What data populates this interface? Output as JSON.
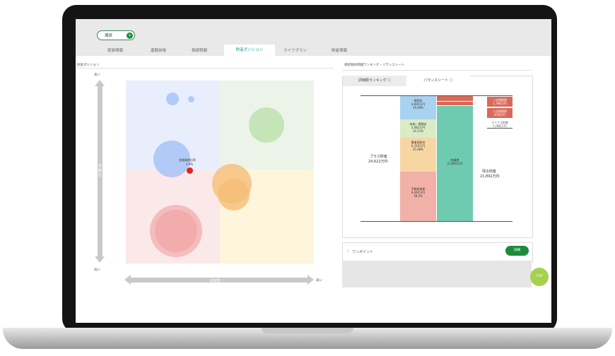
{
  "header": {
    "status_pill": "現状",
    "tabs": [
      "家族情報",
      "還暦前後",
      "相続税額",
      "財産ポジション",
      "ライフプラン",
      "財産情報"
    ],
    "active_tab": "財産ポジション"
  },
  "left_panel": {
    "title": "財産ポジション",
    "y_high": "高い",
    "y_low": "低い",
    "y_axis": "流動性",
    "x_axis": "収益性",
    "x_high": "高い",
    "marker_label": "金融資産比率",
    "marker_value": "1.8%"
  },
  "right_panel": {
    "title": "相続税評価額ランキング・バランスシート",
    "tabs": [
      "評価額ランキング",
      "バランスシート"
    ],
    "active_tab": "バランスシート",
    "plus_label": "プラス財産",
    "plus_value": "24,622万円",
    "remaining_label": "残る財産",
    "remaining_value": "21,892万円",
    "assets": [
      {
        "name": "現預金",
        "value": "4,800万円",
        "pct": "19.49%"
      },
      {
        "name": "有価・保険金",
        "value": "3,482万円",
        "pct": "14.11%"
      },
      {
        "name": "事業用総合",
        "value": "6,310万円",
        "pct": "25.08%"
      },
      {
        "name": "不動産資産",
        "value": "9,440万円",
        "pct": "38.2%"
      }
    ],
    "liabilities": [
      {
        "name": "一次相続税",
        "value": "1,798万円"
      },
      {
        "name": "二次相続税",
        "value": "878万円"
      },
      {
        "name": "マイナス財産",
        "value": "1,068万円"
      }
    ],
    "net_label": "純資産",
    "net_value": "21,892万円",
    "onepoint_label": "ワンポイント",
    "onepoint_button": "詳細",
    "top_button": "TOP"
  },
  "colors": {
    "accent_green": "#1c8c3c",
    "teal": "#6ecbb0",
    "asset_blue": "#a8d2ef",
    "asset_green": "#d9ecc4",
    "asset_orange": "#f6d7a4",
    "asset_red": "#f2b1a8",
    "liability_red": "#d96a5a"
  }
}
